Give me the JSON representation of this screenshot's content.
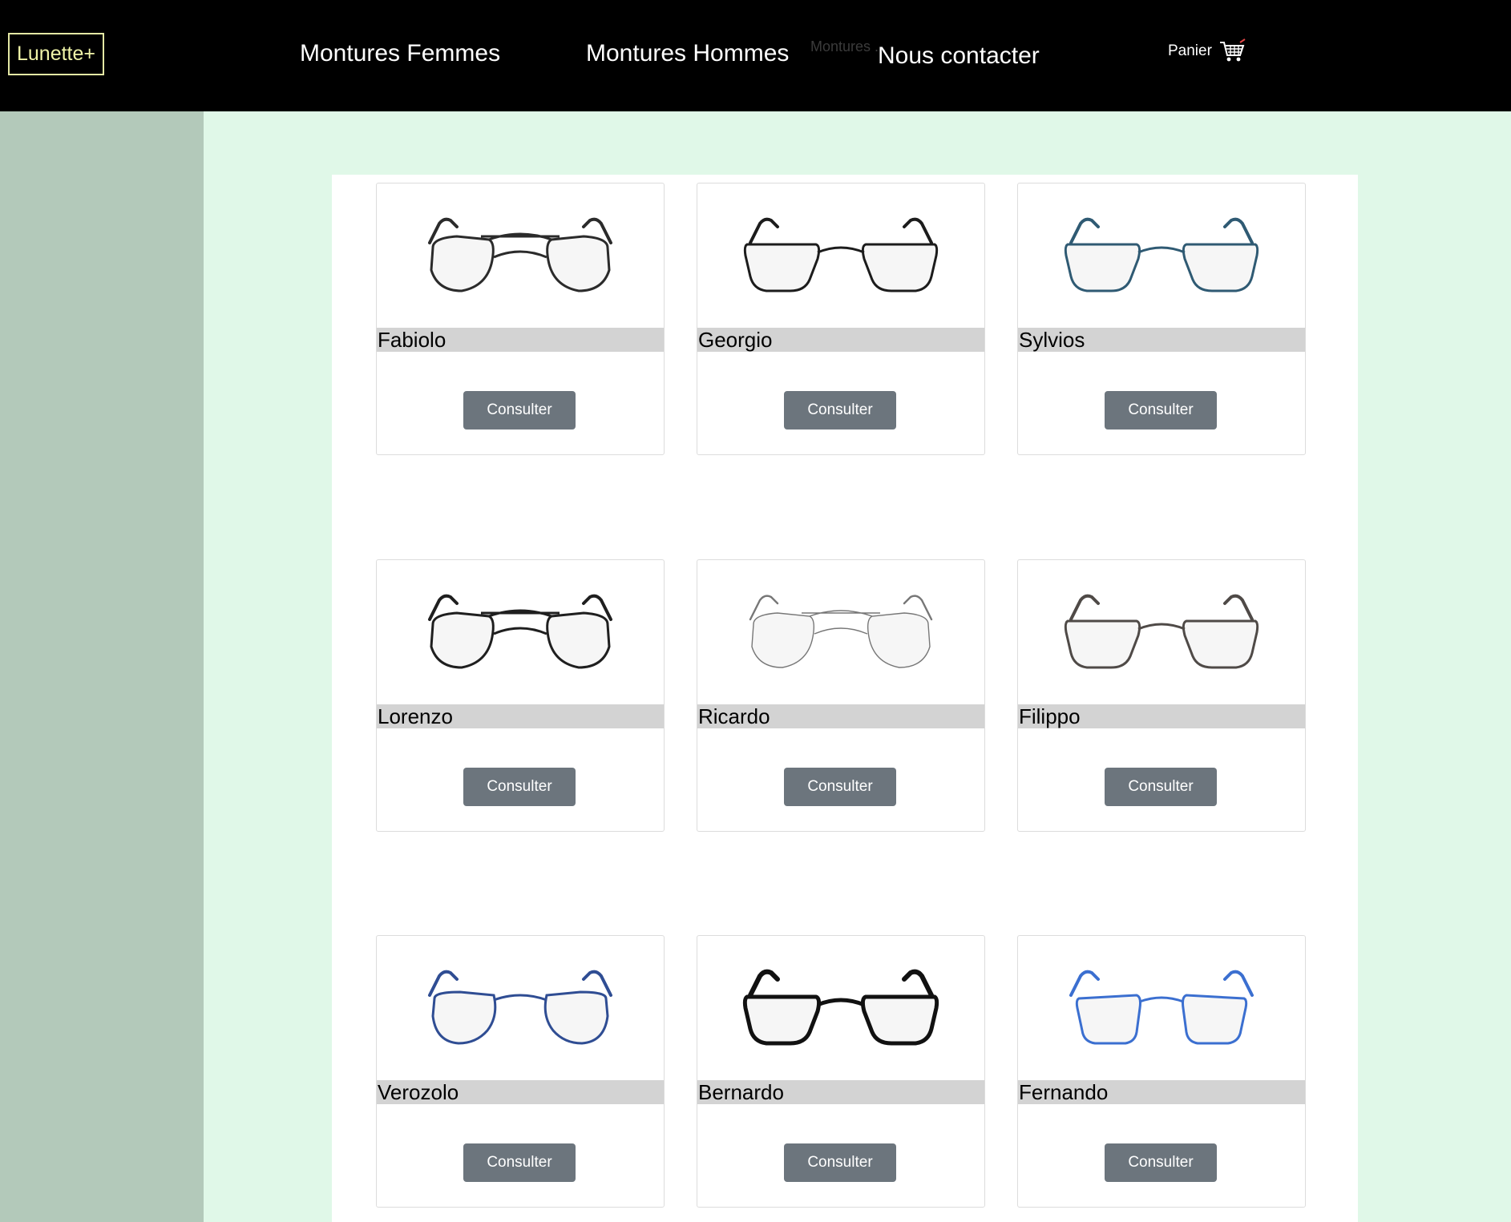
{
  "header": {
    "logo": "Lunette+",
    "nav": {
      "femmes": "Montures Femmes",
      "hommes": "Montures Hommes",
      "contact": "Nous contacter",
      "ghost": "Montures ..."
    },
    "cart_label": "Panier",
    "cart_icon": "shopping-cart-icon"
  },
  "products": [
    {
      "name": "Fabiolo",
      "button": "Consulter",
      "frame": "aviator",
      "color": "#2b2b2b"
    },
    {
      "name": "Georgio",
      "button": "Consulter",
      "frame": "rect",
      "color": "#1c1c1c"
    },
    {
      "name": "Sylvios",
      "button": "Consulter",
      "frame": "rect-wide",
      "color": "#2f5a73"
    },
    {
      "name": "Lorenzo",
      "button": "Consulter",
      "frame": "aviator",
      "color": "#1f1f1f"
    },
    {
      "name": "Ricardo",
      "button": "Consulter",
      "frame": "aviator-thin",
      "color": "#777777"
    },
    {
      "name": "Filippo",
      "button": "Consulter",
      "frame": "rect-metal",
      "color": "#4f4a47"
    },
    {
      "name": "Verozolo",
      "button": "Consulter",
      "frame": "round",
      "color": "#2f4d93"
    },
    {
      "name": "Bernardo",
      "button": "Consulter",
      "frame": "bold",
      "color": "#111111"
    },
    {
      "name": "Fernando",
      "button": "Consulter",
      "frame": "square",
      "color": "#3b6fd0"
    }
  ]
}
